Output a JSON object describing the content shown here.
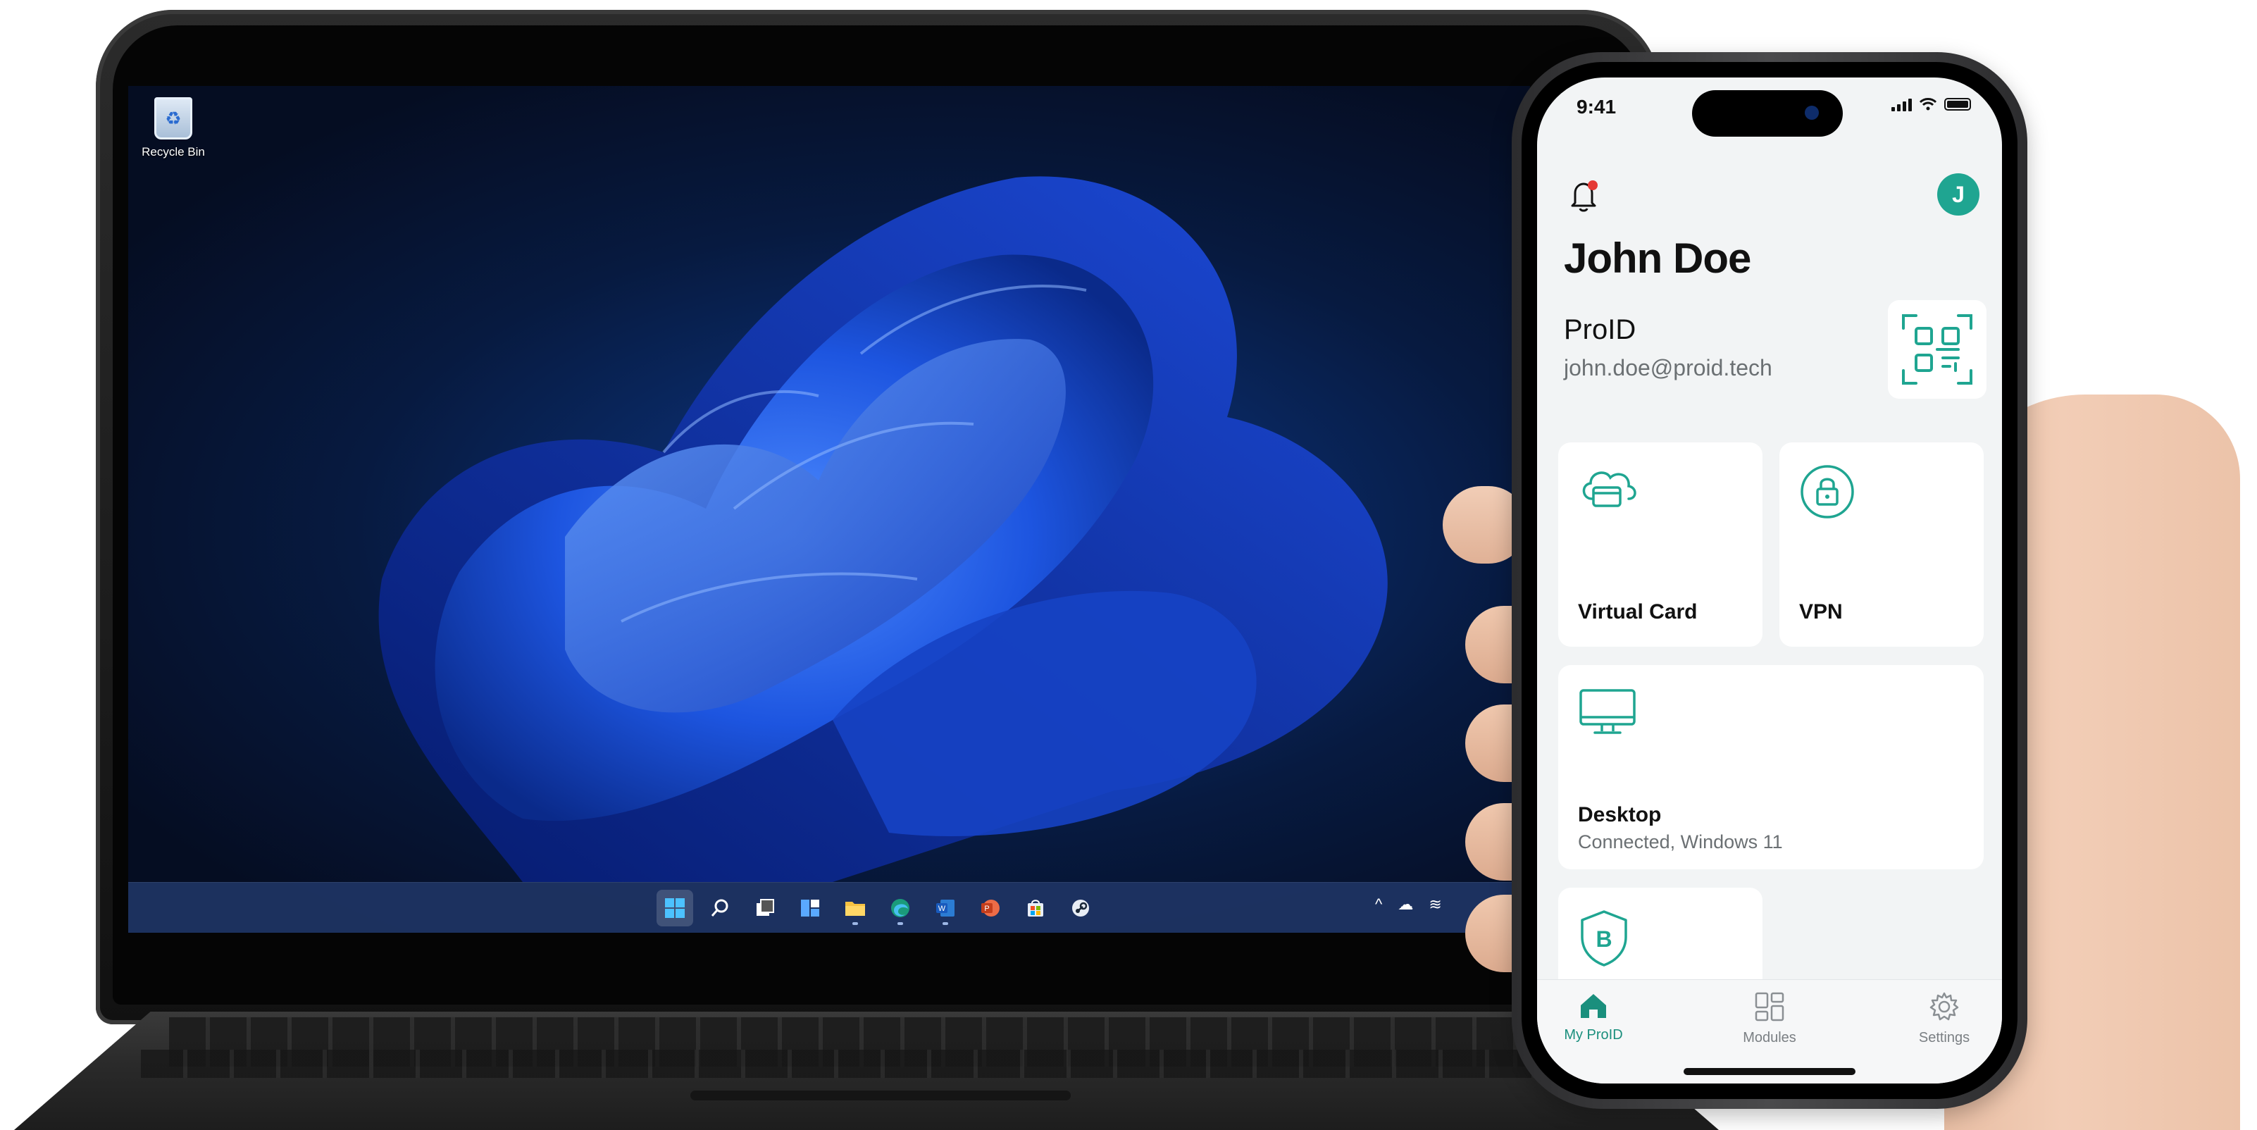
{
  "desktop": {
    "recycle_bin_label": "Recycle Bin",
    "taskbar": {
      "apps": [
        {
          "name": "start-icon",
          "glyph": "⊞"
        },
        {
          "name": "search-icon",
          "glyph": "⌕"
        },
        {
          "name": "task-view-icon",
          "glyph": "❐"
        },
        {
          "name": "widgets-icon",
          "glyph": "▤"
        },
        {
          "name": "file-explorer-icon",
          "glyph": "▰"
        },
        {
          "name": "edge-icon",
          "glyph": "◐"
        },
        {
          "name": "word-icon",
          "glyph": "W"
        },
        {
          "name": "powerpoint-icon",
          "glyph": "P"
        },
        {
          "name": "store-icon",
          "glyph": "▣"
        },
        {
          "name": "steam-icon",
          "glyph": "⚙"
        }
      ],
      "tray": [
        "^",
        "☁",
        "≋"
      ]
    }
  },
  "phone": {
    "status": {
      "time": "9:41"
    },
    "header": {
      "avatar_initial": "J"
    },
    "user": {
      "name": "John Doe"
    },
    "proid": {
      "title": "ProID",
      "email": "john.doe@proid.tech"
    },
    "modules": {
      "virtual_card": {
        "title": "Virtual Card"
      },
      "vpn": {
        "title": "VPN"
      },
      "desktop": {
        "title": "Desktop",
        "status": "Connected, Windows 11"
      }
    },
    "nav": {
      "my_proid": "My ProID",
      "modules": "Modules",
      "settings": "Settings"
    },
    "colors": {
      "accent": "#1fa591",
      "background": "#f2f4f5"
    }
  }
}
